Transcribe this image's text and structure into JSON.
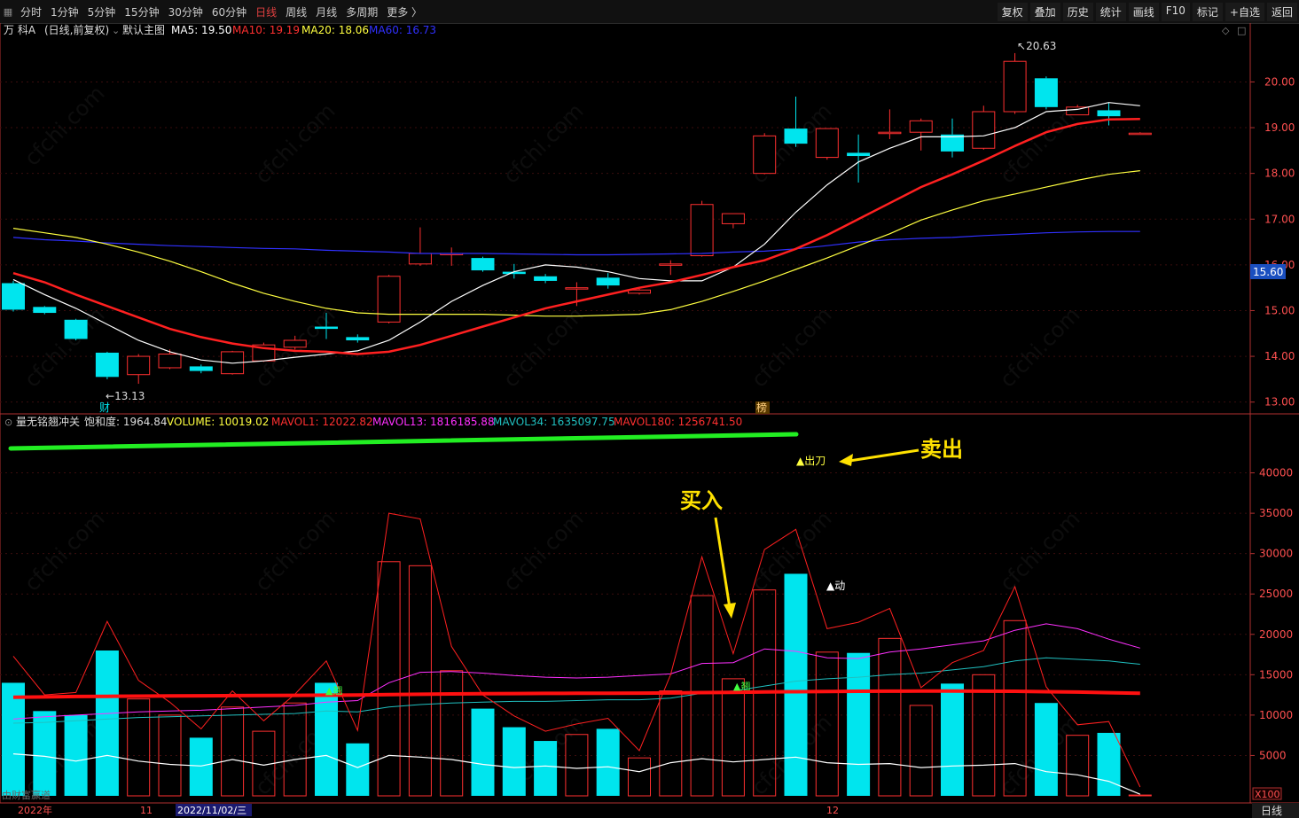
{
  "toolbar": {
    "periods": [
      "分时",
      "1分钟",
      "5分钟",
      "15分钟",
      "30分钟",
      "60分钟",
      "日线",
      "周线",
      "月线",
      "多周期",
      "更多 〉"
    ],
    "active_period": "日线",
    "tools": [
      "复权",
      "叠加",
      "历史",
      "统计",
      "画线",
      "F10",
      "标记",
      "+自选",
      "返回"
    ]
  },
  "main_header": {
    "title": "万 科A",
    "mode": "(日线,前复权)",
    "template": "默认主图",
    "ma5": "MA5: 19.50",
    "ma10": "MA10: 19.19",
    "ma20": "MA20: 18.06",
    "ma60": "MA60: 16.73"
  },
  "sub_header": {
    "indicator": "量无铭翘冲关",
    "saturation": "饱和度: 1964.84",
    "volume": "VOLUME: 10019.02",
    "mavol1": "MAVOL1: 12022.82",
    "mavol13": "MAVOL13: 1816185.88",
    "mavol34": "MAVOL34: 1635097.75",
    "mavol180": "MAVOL180: 1256741.50"
  },
  "price_axis": [
    "20.00",
    "19.00",
    "18.00",
    "17.00",
    "16.00",
    "15.00",
    "14.00",
    "13.00"
  ],
  "current_price": "15.60",
  "volume_axis": [
    "40000",
    "35000",
    "30000",
    "25000",
    "20000",
    "15000",
    "10000",
    "5000"
  ],
  "volume_unit": "X100",
  "markers": {
    "high": "20.63",
    "low": "13.13",
    "fin_label": "财",
    "bang_label": "榜",
    "sell_signal": "▲出刀",
    "move_signal": "▲动",
    "up_tag": "▲翘",
    "up_tag_2": "▲翘",
    "source": "由财富赢道"
  },
  "annotations": {
    "sell": "卖出",
    "buy": "买入"
  },
  "date_axis": {
    "year": "2022年",
    "nov": "11",
    "selected": "2022/11/02/三",
    "dec": "12"
  },
  "period_corner": "日线",
  "watermark": "cfchi.com",
  "colors": {
    "up": "#ff3030",
    "down": "#00e5ee",
    "ma5": "#ffffff",
    "ma10": "#ff2020",
    "ma20": "#ffff40",
    "ma60": "#3030ff",
    "mavol13": "#ff30ff",
    "mavol34": "#20c0c0",
    "grid": "#3a0d0d",
    "axis": "#b03030",
    "annotation": "#ffe100"
  },
  "chart_data": [
    {
      "type": "candlestick",
      "title": "万 科A (日线,前复权)",
      "ylim": [
        12.8,
        20.9
      ],
      "candles": [
        {
          "o": 15.6,
          "h": 15.65,
          "l": 14.98,
          "c": 15.02
        },
        {
          "o": 15.08,
          "h": 15.1,
          "l": 14.92,
          "c": 14.95
        },
        {
          "o": 14.8,
          "h": 14.82,
          "l": 14.35,
          "c": 14.38
        },
        {
          "o": 14.08,
          "h": 14.1,
          "l": 13.5,
          "c": 13.55
        },
        {
          "o": 13.6,
          "h": 14.05,
          "l": 13.4,
          "c": 14.0
        },
        {
          "o": 13.75,
          "h": 14.15,
          "l": 13.72,
          "c": 14.05
        },
        {
          "o": 13.78,
          "h": 13.82,
          "l": 13.63,
          "c": 13.68
        },
        {
          "o": 13.62,
          "h": 14.12,
          "l": 13.6,
          "c": 14.1
        },
        {
          "o": 13.9,
          "h": 14.3,
          "l": 13.88,
          "c": 14.25
        },
        {
          "o": 14.2,
          "h": 14.45,
          "l": 14.15,
          "c": 14.35
        },
        {
          "o": 14.65,
          "h": 14.95,
          "l": 14.38,
          "c": 14.6
        },
        {
          "o": 14.42,
          "h": 14.48,
          "l": 14.3,
          "c": 14.35
        },
        {
          "o": 14.75,
          "h": 15.78,
          "l": 14.72,
          "c": 15.75
        },
        {
          "o": 16.02,
          "h": 16.82,
          "l": 15.98,
          "c": 16.25
        },
        {
          "o": 16.24,
          "h": 16.38,
          "l": 15.98,
          "c": 16.25
        },
        {
          "o": 16.15,
          "h": 16.18,
          "l": 15.85,
          "c": 15.88
        },
        {
          "o": 15.85,
          "h": 16.02,
          "l": 15.7,
          "c": 15.8
        },
        {
          "o": 15.75,
          "h": 15.8,
          "l": 15.6,
          "c": 15.65
        },
        {
          "o": 15.48,
          "h": 15.62,
          "l": 15.1,
          "c": 15.5
        },
        {
          "o": 15.72,
          "h": 15.82,
          "l": 15.48,
          "c": 15.55
        },
        {
          "o": 15.38,
          "h": 15.48,
          "l": 15.35,
          "c": 15.45
        },
        {
          "o": 16.0,
          "h": 16.1,
          "l": 15.78,
          "c": 16.02
        },
        {
          "o": 16.2,
          "h": 17.4,
          "l": 16.18,
          "c": 17.32
        },
        {
          "o": 16.9,
          "h": 17.12,
          "l": 16.8,
          "c": 17.12
        },
        {
          "o": 18.0,
          "h": 18.88,
          "l": 17.98,
          "c": 18.82
        },
        {
          "o": 18.98,
          "h": 19.68,
          "l": 18.58,
          "c": 18.65
        },
        {
          "o": 18.35,
          "h": 18.98,
          "l": 18.3,
          "c": 18.98
        },
        {
          "o": 18.45,
          "h": 18.85,
          "l": 17.8,
          "c": 18.38
        },
        {
          "o": 18.88,
          "h": 19.4,
          "l": 18.75,
          "c": 18.9
        },
        {
          "o": 18.9,
          "h": 19.2,
          "l": 18.5,
          "c": 19.15
        },
        {
          "o": 18.85,
          "h": 19.2,
          "l": 18.35,
          "c": 18.48
        },
        {
          "o": 18.55,
          "h": 19.48,
          "l": 18.52,
          "c": 19.35
        },
        {
          "o": 19.35,
          "h": 20.63,
          "l": 19.3,
          "c": 20.45
        },
        {
          "o": 20.08,
          "h": 20.12,
          "l": 19.4,
          "c": 19.45
        },
        {
          "o": 19.28,
          "h": 19.5,
          "l": 19.3,
          "c": 19.45
        },
        {
          "o": 19.38,
          "h": 19.55,
          "l": 19.05,
          "c": 19.25
        },
        {
          "o": 18.88,
          "h": 18.9,
          "l": 18.86,
          "c": 18.88
        }
      ],
      "ma5": [
        15.68,
        15.35,
        15.05,
        14.7,
        14.35,
        14.1,
        13.92,
        13.85,
        13.9,
        13.98,
        14.05,
        14.12,
        14.35,
        14.75,
        15.2,
        15.55,
        15.85,
        16.0,
        15.95,
        15.85,
        15.7,
        15.65,
        15.65,
        15.95,
        16.45,
        17.15,
        17.75,
        18.25,
        18.55,
        18.8,
        18.8,
        18.82,
        19.0,
        19.35,
        19.4,
        19.55,
        19.48
      ],
      "ma10": [
        15.82,
        15.62,
        15.35,
        15.1,
        14.85,
        14.6,
        14.42,
        14.28,
        14.18,
        14.12,
        14.1,
        14.05,
        14.1,
        14.25,
        14.45,
        14.65,
        14.85,
        15.05,
        15.2,
        15.35,
        15.5,
        15.62,
        15.78,
        15.95,
        16.1,
        16.35,
        16.65,
        17.0,
        17.35,
        17.7,
        17.98,
        18.28,
        18.6,
        18.9,
        19.08,
        19.18,
        19.19
      ],
      "ma20": [
        16.8,
        16.7,
        16.6,
        16.45,
        16.28,
        16.08,
        15.85,
        15.6,
        15.38,
        15.2,
        15.05,
        14.95,
        14.92,
        14.92,
        14.92,
        14.92,
        14.9,
        14.88,
        14.88,
        14.9,
        14.92,
        15.02,
        15.2,
        15.42,
        15.65,
        15.9,
        16.15,
        16.42,
        16.68,
        16.98,
        17.2,
        17.4,
        17.55,
        17.7,
        17.85,
        17.98,
        18.06
      ],
      "ma60": [
        16.6,
        16.55,
        16.52,
        16.48,
        16.45,
        16.42,
        16.4,
        16.38,
        16.36,
        16.35,
        16.32,
        16.3,
        16.28,
        16.25,
        16.25,
        16.25,
        16.24,
        16.23,
        16.22,
        16.22,
        16.23,
        16.24,
        16.25,
        16.28,
        16.3,
        16.35,
        16.42,
        16.5,
        16.55,
        16.58,
        16.6,
        16.64,
        16.67,
        16.7,
        16.72,
        16.73,
        16.73
      ]
    },
    {
      "type": "bar",
      "title": "量无铭翘冲关",
      "ylim": [
        0,
        45000
      ],
      "volume": [
        14000,
        10500,
        10000,
        18000,
        12000,
        10000,
        7200,
        11000,
        8000,
        11500,
        14000,
        6500,
        29000,
        28500,
        15500,
        10800,
        8500,
        6800,
        7600,
        8300,
        4700,
        13000,
        24800,
        14500,
        25500,
        27500,
        17800,
        17700,
        19500,
        11200,
        13900,
        15000,
        21700,
        11500,
        7500,
        7800,
        100
      ],
      "mavol1": [
        17300,
        12500,
        12800,
        21600,
        14300,
        11600,
        8300,
        13000,
        9300,
        12600,
        16700,
        8100,
        35000,
        34300,
        18500,
        12500,
        9900,
        8000,
        8900,
        9600,
        5600,
        15000,
        29600,
        17600,
        30500,
        33000,
        20700,
        21500,
        23200,
        13400,
        16500,
        18000,
        25900,
        13500,
        8800,
        9200,
        1100
      ],
      "mavol13": [
        9500,
        9800,
        10000,
        10200,
        10400,
        10500,
        10600,
        10800,
        11000,
        11200,
        11600,
        11800,
        14000,
        15300,
        15400,
        15200,
        14900,
        14700,
        14600,
        14700,
        14900,
        15100,
        16400,
        16500,
        18200,
        17900,
        17100,
        17000,
        17800,
        18200,
        18700,
        19200,
        20500,
        21300,
        20700,
        19400,
        18300
      ],
      "mavol34": [
        9000,
        9100,
        9300,
        9500,
        9700,
        9800,
        9900,
        10000,
        10100,
        10200,
        10500,
        10400,
        11000,
        11300,
        11500,
        11600,
        11700,
        11700,
        11800,
        11900,
        11900,
        12100,
        12700,
        13000,
        13600,
        14200,
        14500,
        14700,
        15000,
        15200,
        15600,
        16000,
        16700,
        17100,
        16900,
        16700,
        16300
      ],
      "mavol180": [
        12200,
        12250,
        12300,
        12330,
        12350,
        12370,
        12390,
        12410,
        12430,
        12450,
        12470,
        12480,
        12530,
        12580,
        12620,
        12650,
        12670,
        12690,
        12700,
        12710,
        12720,
        12740,
        12790,
        12820,
        12870,
        12900,
        12930,
        12950,
        12960,
        12970,
        12970,
        12960,
        12950,
        12900,
        12850,
        12780,
        12700
      ],
      "saturation_line": [
        5200,
        4900,
        4300,
        5000,
        4300,
        3900,
        3700,
        4500,
        3800,
        4500,
        5000,
        3500,
        5000,
        4800,
        4500,
        3900,
        3500,
        3700,
        3400,
        3600,
        3000,
        4100,
        4600,
        4200,
        4500,
        4800,
        4100,
        3900,
        4000,
        3500,
        3700,
        3800,
        4000,
        3000,
        2600,
        1800,
        200
      ]
    }
  ]
}
